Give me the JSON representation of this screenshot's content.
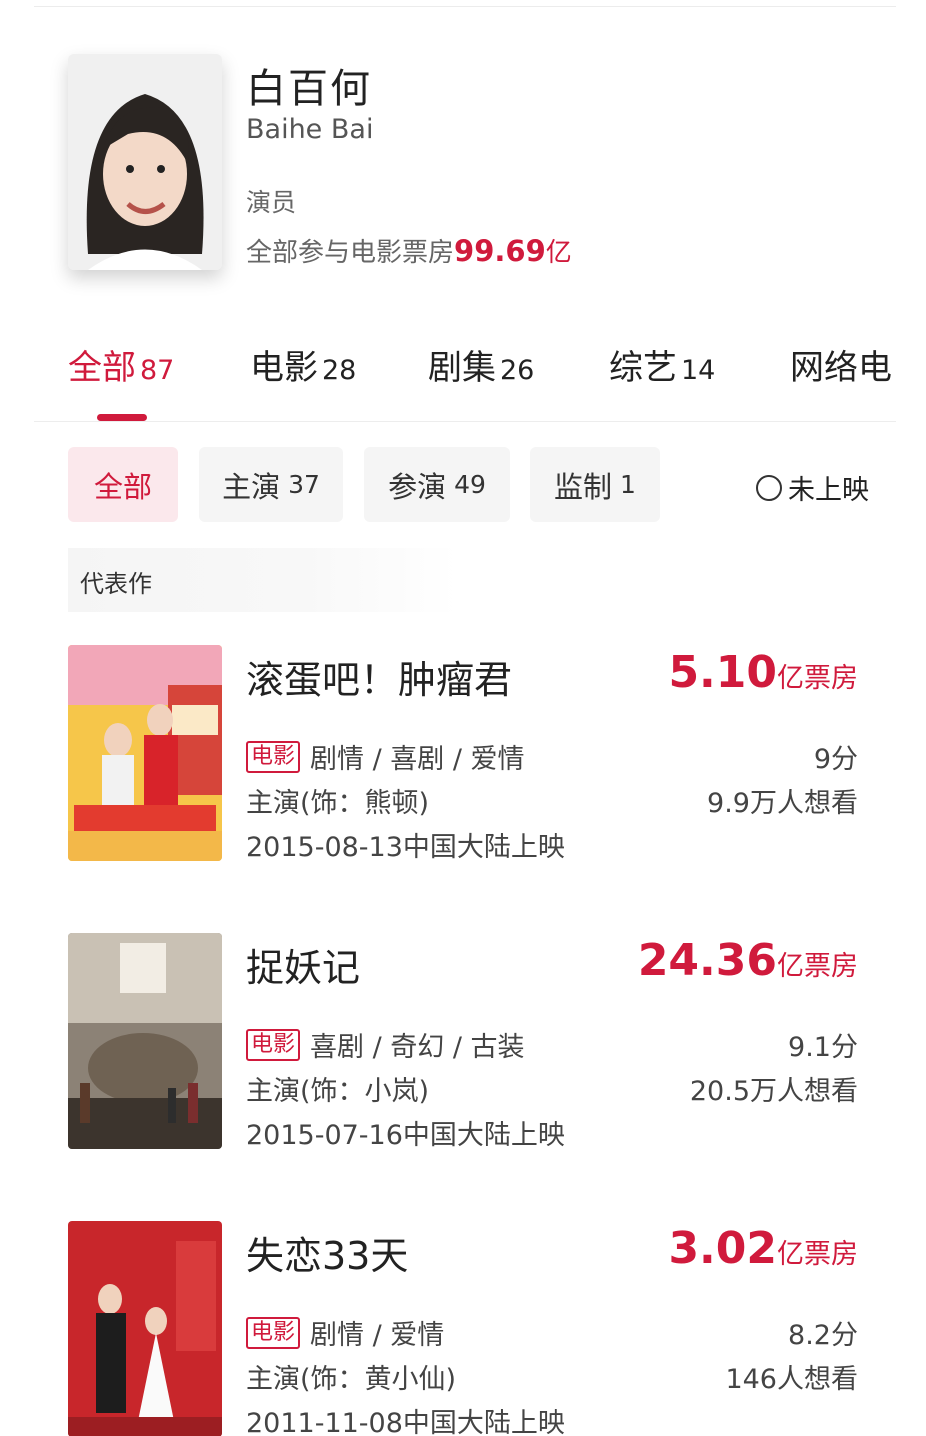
{
  "profile": {
    "name_cn": "白百何",
    "name_en": "Baihe Bai",
    "role": "演员",
    "boxoffice_prefix": "全部参与电影票房",
    "boxoffice_amount": "99.69",
    "boxoffice_unit": "亿"
  },
  "main_tabs": [
    {
      "label": "全部",
      "count": "87"
    },
    {
      "label": "电影",
      "count": "28"
    },
    {
      "label": "剧集",
      "count": "26"
    },
    {
      "label": "综艺",
      "count": "14"
    },
    {
      "label": "网络电",
      "count": ""
    }
  ],
  "filters": [
    {
      "label": "全部",
      "count": ""
    },
    {
      "label": "主演",
      "count": "37"
    },
    {
      "label": "参演",
      "count": "49"
    },
    {
      "label": "监制",
      "count": "1"
    }
  ],
  "unreleased_label": "未上映",
  "section_label": "代表作",
  "movies": [
    {
      "title": "滚蛋吧！肿瘤君",
      "box_num": "5.10",
      "box_unit": "亿票房",
      "tag": "电影",
      "genres": "剧情 / 喜剧 / 爱情",
      "role": "主演(饰：熊顿)",
      "release": "2015-08-13中国大陆上映",
      "score": "9分",
      "want": "9.9万人想看"
    },
    {
      "title": "捉妖记",
      "box_num": "24.36",
      "box_unit": "亿票房",
      "tag": "电影",
      "genres": "喜剧 / 奇幻 / 古装",
      "role": "主演(饰：小岚)",
      "release": "2015-07-16中国大陆上映",
      "score": "9.1分",
      "want": "20.5万人想看"
    },
    {
      "title": "失恋33天",
      "box_num": "3.02",
      "box_unit": "亿票房",
      "tag": "电影",
      "genres": "剧情 / 爱情",
      "role": "主演(饰：黄小仙)",
      "release": "2011-11-08中国大陆上映",
      "score": "8.2分",
      "want": "146人想看"
    }
  ],
  "colors": {
    "accent": "#d01a3c",
    "chip_bg": "#f5f5f5",
    "chip_active_bg": "#fbe8ec"
  }
}
